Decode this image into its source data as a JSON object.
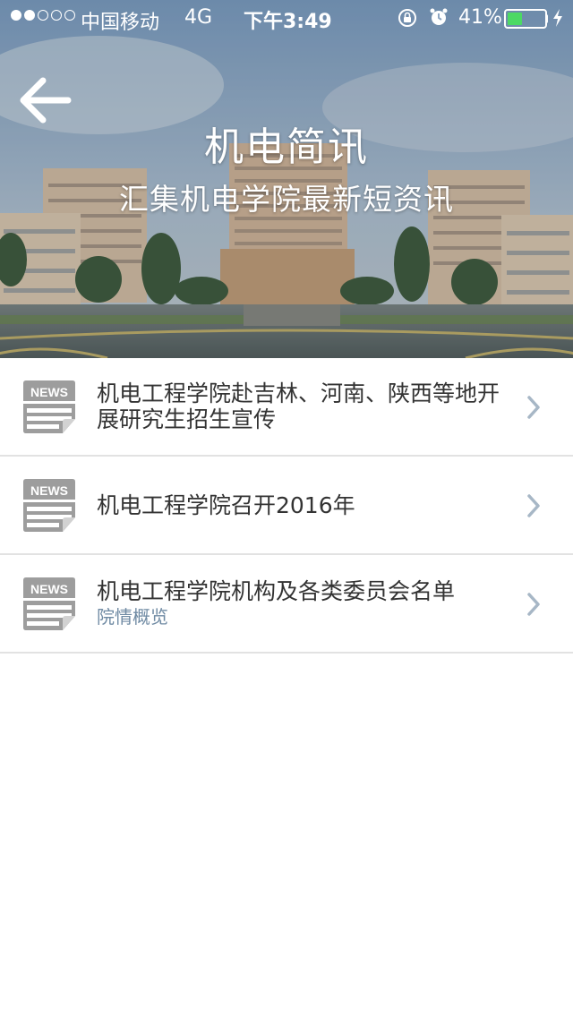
{
  "status_bar": {
    "carrier": "中国移动",
    "network": "4G",
    "time": "下午3:49",
    "battery_percent": "41%",
    "battery_level": 0.41,
    "signal_strength": 2,
    "icons": [
      "rotation-lock-icon",
      "alarm-icon",
      "battery-icon",
      "charging-icon"
    ]
  },
  "header": {
    "title": "机电简讯",
    "subtitle": "汇集机电学院最新短资讯",
    "back_icon": "back-arrow-icon"
  },
  "news": {
    "items": [
      {
        "title": "机电工程学院赴吉林、河南、陕西等地开展研究生招生宣传",
        "category": "",
        "icon": "news-icon"
      },
      {
        "title": "机电工程学院召开2016年",
        "category": "",
        "icon": "news-icon"
      },
      {
        "title": "机电工程学院机构及各类委员会名单",
        "category": "院情概览",
        "icon": "news-icon"
      }
    ]
  },
  "colors": {
    "chevron": "#a7b7c6",
    "category_text": "#6f8aa3",
    "title_text": "#333333",
    "divider": "#e2e2e2",
    "battery_fill": "#4cd964"
  }
}
